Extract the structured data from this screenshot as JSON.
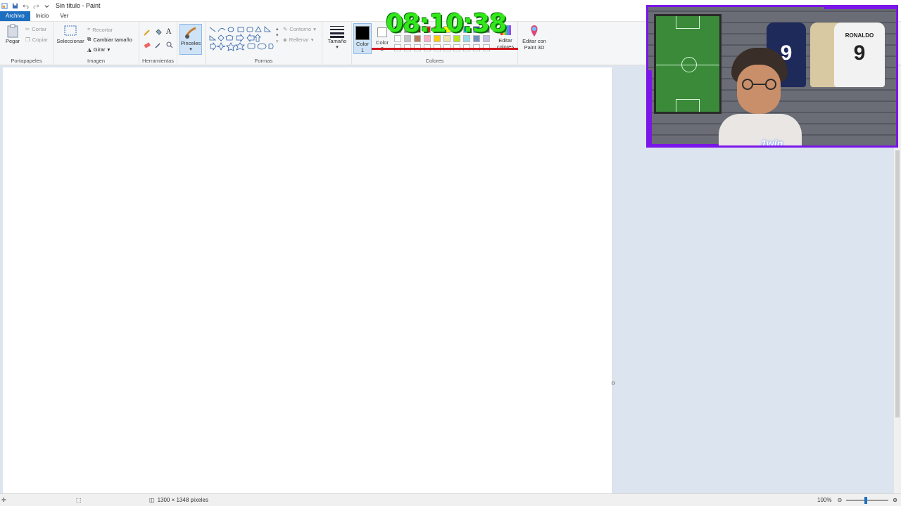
{
  "window": {
    "title": "Sin título - Paint"
  },
  "tabs": [
    "Archivo",
    "Inicio",
    "Ver"
  ],
  "ribbon": {
    "clipboard": {
      "paste": "Pegar",
      "cut": "Cortar",
      "copy": "Copiar",
      "group": "Portapapeles"
    },
    "image": {
      "select": "Seleccionar",
      "crop": "Recortar",
      "resize": "Cambiar tamaño",
      "rotate": "Girar",
      "group": "Imagen"
    },
    "tools": {
      "group": "Herramientas"
    },
    "brushes": {
      "label": "Pinceles"
    },
    "shapes": {
      "outline": "Contorno",
      "fill": "Rellenar",
      "group": "Formas"
    },
    "size": {
      "label": "Tamaño"
    },
    "colors": {
      "color1": "Color 1",
      "color1_line1": "Color",
      "color1_line2": "1",
      "color2": "Color 2",
      "color2_line1": "Color",
      "color2_line2": "2",
      "edit_line1": "Editar",
      "edit_line2": "colores",
      "group": "Colores",
      "color1_value": "#000000",
      "color2_value": "#ffffff",
      "palette_row1": [
        "#000000",
        "#7f7f7f",
        "#880015",
        "#ed1c24",
        "#ff7f27",
        "#fff200",
        "#22b14c",
        "#00a2e8",
        "#3f48cc",
        "#a349a4"
      ],
      "palette_row2": [
        "#ffffff",
        "#c3c3c3",
        "#b97a57",
        "#ffaec9",
        "#ffc90e",
        "#efe4b0",
        "#b5e61d",
        "#99d9ea",
        "#7092be",
        "#c8bfe7"
      ],
      "palette_row3": [
        "#ffffff",
        "#ffffff",
        "#ffffff",
        "#ffffff",
        "#ffffff",
        "#ffffff",
        "#ffffff",
        "#ffffff",
        "#ffffff",
        "#ffffff"
      ]
    },
    "paint3d": {
      "line1": "Editar con",
      "line2": "Paint 3D"
    }
  },
  "overlay": {
    "timer": "08:10:38",
    "webcam": {
      "brand": "1win",
      "shirt_name": "RONALDO",
      "shirt_number": "9",
      "shirt2_number": "9"
    }
  },
  "status": {
    "dimensions": "1300 × 1348 píxeles",
    "zoom": "100%"
  }
}
